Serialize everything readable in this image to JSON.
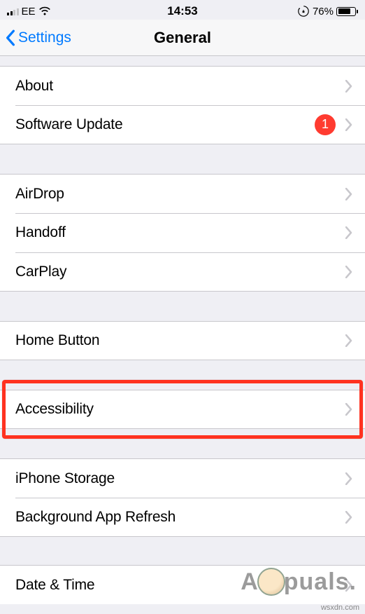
{
  "status_bar": {
    "carrier": "EE",
    "time": "14:53",
    "battery_pct": "76%"
  },
  "nav": {
    "back_label": "Settings",
    "title": "General"
  },
  "groups": [
    {
      "items": [
        {
          "label": "About",
          "badge": null
        },
        {
          "label": "Software Update",
          "badge": "1"
        }
      ]
    },
    {
      "items": [
        {
          "label": "AirDrop",
          "badge": null
        },
        {
          "label": "Handoff",
          "badge": null
        },
        {
          "label": "CarPlay",
          "badge": null
        }
      ]
    },
    {
      "items": [
        {
          "label": "Home Button",
          "badge": null
        }
      ]
    },
    {
      "items": [
        {
          "label": "Accessibility",
          "badge": null
        }
      ],
      "highlighted": true
    },
    {
      "items": [
        {
          "label": "iPhone Storage",
          "badge": null
        },
        {
          "label": "Background App Refresh",
          "badge": null
        }
      ]
    },
    {
      "items": [
        {
          "label": "Date & Time",
          "badge": null
        }
      ]
    }
  ],
  "watermark": {
    "pre": "A",
    "post": "puals."
  },
  "source": "wsxdn.com"
}
